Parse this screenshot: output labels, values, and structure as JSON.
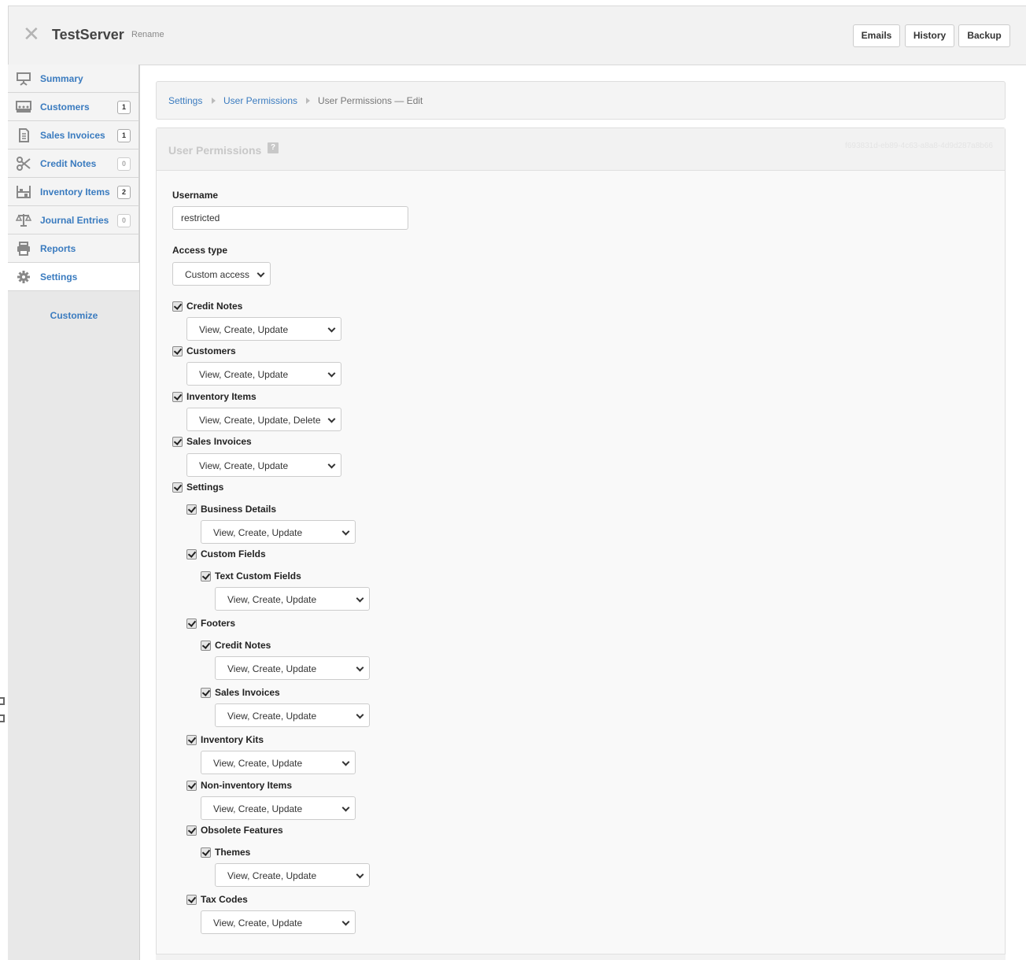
{
  "header": {
    "close_icon": "close-icon",
    "title": "TestServer",
    "rename_label": "Rename",
    "buttons": [
      "Emails",
      "History",
      "Backup"
    ]
  },
  "sidebar": {
    "items": [
      {
        "label": "Summary",
        "icon": "presentation-board-icon",
        "badge": null
      },
      {
        "label": "Customers",
        "icon": "customers-icon",
        "badge": "1"
      },
      {
        "label": "Sales Invoices",
        "icon": "document-icon",
        "badge": "1"
      },
      {
        "label": "Credit Notes",
        "icon": "scissors-icon",
        "badge": "0"
      },
      {
        "label": "Inventory Items",
        "icon": "warehouse-icon",
        "badge": "2"
      },
      {
        "label": "Journal Entries",
        "icon": "scales-icon",
        "badge": "0"
      },
      {
        "label": "Reports",
        "icon": "printer-icon",
        "badge": null
      },
      {
        "label": "Settings",
        "icon": "gear-icon",
        "badge": null
      }
    ],
    "active": "Settings",
    "customize_label": "Customize"
  },
  "breadcrumb": {
    "items": [
      "Settings",
      "User Permissions",
      "User Permissions — Edit"
    ]
  },
  "panel": {
    "title": "User Permissions",
    "help_icon": "?",
    "guid": "f693831d-eb89-4c63-a8a8-4d9d287a8b66"
  },
  "form": {
    "username_label": "Username",
    "username_value": "restricted",
    "access_type_label": "Access type",
    "access_type_value": "Custom access",
    "permissions": [
      {
        "label": "Credit Notes",
        "checked": true,
        "select": "View, Create, Update"
      },
      {
        "label": "Customers",
        "checked": true,
        "select": "View, Create, Update"
      },
      {
        "label": "Inventory Items",
        "checked": true,
        "select": "View, Create, Update, Delete"
      },
      {
        "label": "Sales Invoices",
        "checked": true,
        "select": "View, Create, Update"
      },
      {
        "label": "Settings",
        "checked": true,
        "select": null
      },
      {
        "label": "Business Details",
        "checked": true,
        "select": "View, Create, Update"
      },
      {
        "label": "Custom Fields",
        "checked": true,
        "select": null
      },
      {
        "label": "Text Custom Fields",
        "checked": true,
        "select": "View, Create, Update"
      },
      {
        "label": "Footers",
        "checked": true,
        "select": null
      },
      {
        "label": "Credit Notes",
        "checked": true,
        "select": "View, Create, Update"
      },
      {
        "label": "Sales Invoices",
        "checked": true,
        "select": "View, Create, Update"
      },
      {
        "label": "Inventory Kits",
        "checked": true,
        "select": "View, Create, Update"
      },
      {
        "label": "Non-inventory Items",
        "checked": true,
        "select": "View, Create, Update"
      },
      {
        "label": "Obsolete Features",
        "checked": true,
        "select": null
      },
      {
        "label": "Themes",
        "checked": true,
        "select": "View, Create, Update"
      },
      {
        "label": "Tax Codes",
        "checked": true,
        "select": "View, Create, Update"
      }
    ]
  }
}
